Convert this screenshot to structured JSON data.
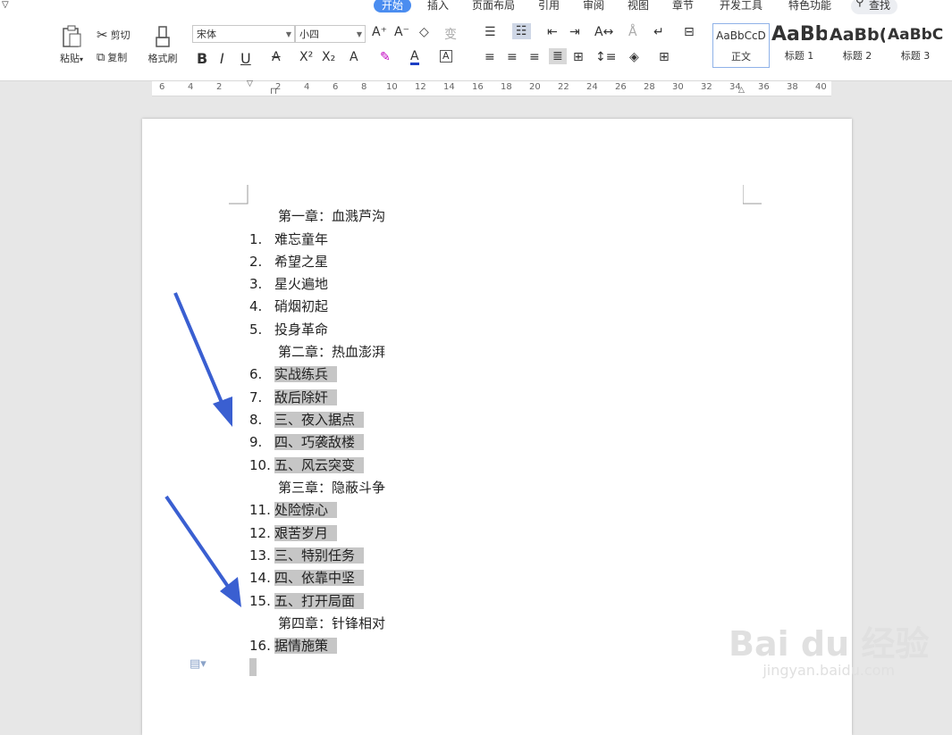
{
  "menu_tabs": [
    "开始",
    "插入",
    "页面布局",
    "引用",
    "审阅",
    "视图",
    "章节",
    "开发工具",
    "特色功能"
  ],
  "search_label": "查找",
  "ribbon": {
    "paste_label": "粘贴",
    "cut_label": "剪切",
    "copy_label": "复制",
    "format_painter_label": "格式刷",
    "font_name": "宋体",
    "font_size": "小四",
    "styles": [
      {
        "sample": "AaBbCcD",
        "caption": "正文"
      },
      {
        "sample": "AaBb",
        "caption": "标题 1"
      },
      {
        "sample": "AaBb(",
        "caption": "标题 2"
      },
      {
        "sample": "AaBbC",
        "caption": "标题 3"
      }
    ]
  },
  "ruler_numbers": [
    "6",
    "4",
    "2",
    "2",
    "4",
    "6",
    "8",
    "10",
    "12",
    "14",
    "16",
    "18",
    "20",
    "22",
    "24",
    "26",
    "28",
    "30",
    "32",
    "34",
    "36",
    "38",
    "40"
  ],
  "document": {
    "chapter1": "第一章：血溅芦沟",
    "list1": [
      "难忘童年",
      "希望之星",
      "星火遍地",
      "硝烟初起",
      "投身革命"
    ],
    "chapter2": "第二章：热血澎湃",
    "list2": [
      "实战练兵",
      "敌后除奸",
      "三、夜入据点",
      "四、巧袭敌楼",
      "五、风云突变"
    ],
    "chapter3": "第三章：隐蔽斗争",
    "list3": [
      "处险惊心",
      "艰苦岁月",
      "三、特别任务",
      "四、依靠中坚",
      "五、打开局面"
    ],
    "chapter4": "第四章：针锋相对",
    "list4": [
      "据情施策"
    ],
    "numbers": [
      "1.",
      "2.",
      "3.",
      "4.",
      "5.",
      "6.",
      "7.",
      "8.",
      "9.",
      "10.",
      "11.",
      "12.",
      "13.",
      "14.",
      "15.",
      "16."
    ]
  },
  "watermark": {
    "brand": "Bai du 经验",
    "url": "jingyan.baidu.com"
  },
  "colors": {
    "accent": "#4b8df0",
    "arrow": "#3a5fd1",
    "highlight": "#c6c6c6"
  }
}
